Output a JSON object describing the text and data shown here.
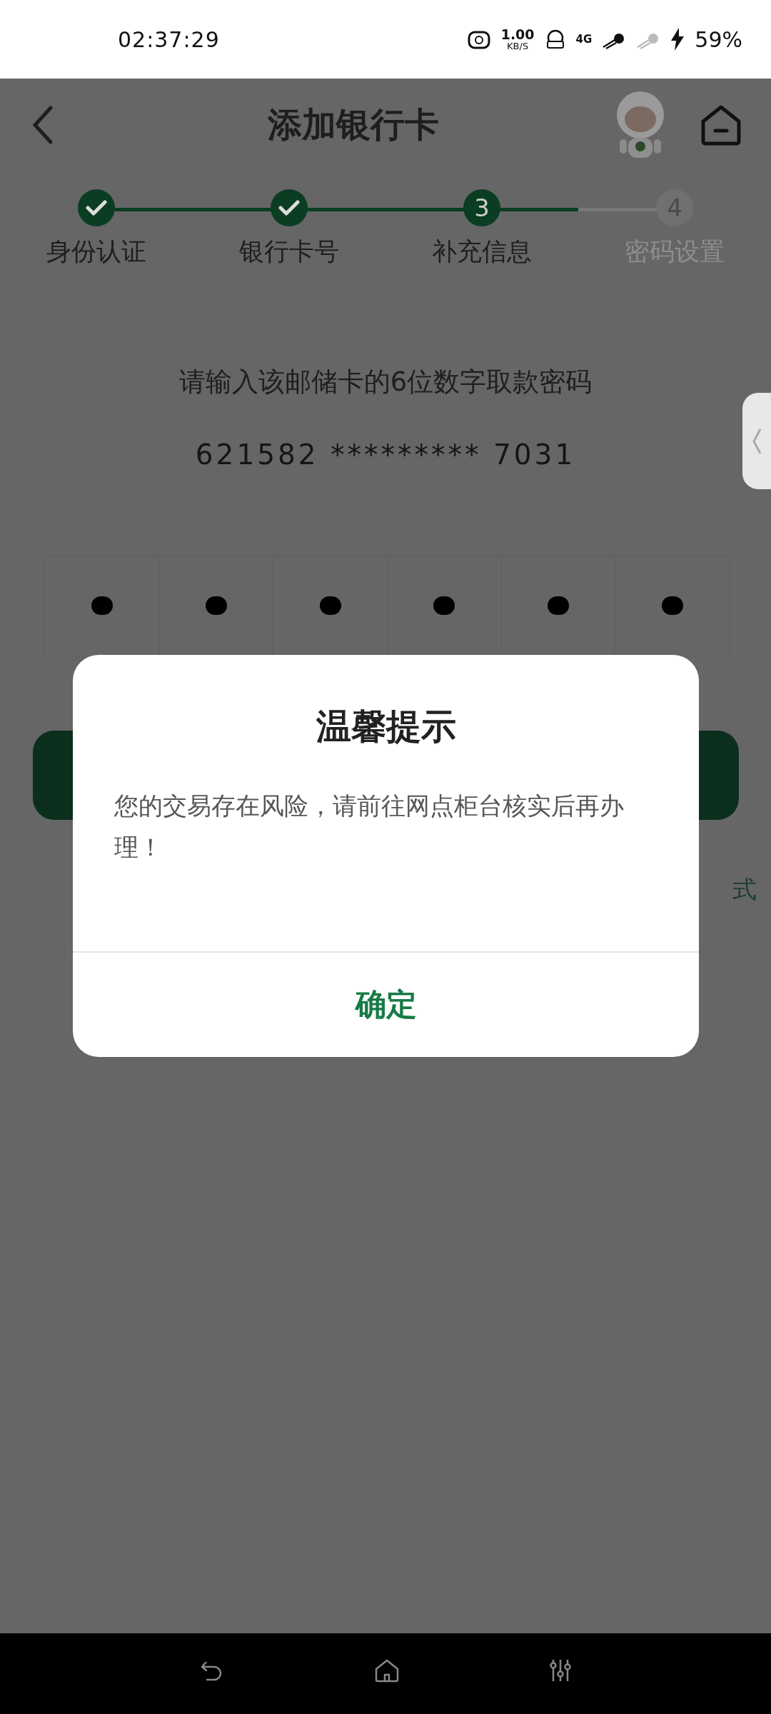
{
  "status_bar": {
    "time": "02:37:29",
    "speed_value": "1.00",
    "speed_unit": "KB/S",
    "network": "4G",
    "battery": "59%"
  },
  "header": {
    "title": "添加银行卡"
  },
  "steps": [
    {
      "label": "身份认证",
      "completed": true,
      "selected": false
    },
    {
      "label": "银行卡号",
      "completed": true,
      "selected": false
    },
    {
      "label": "补充信息",
      "completed": false,
      "selected": true,
      "number": "3"
    },
    {
      "label": "密码设置",
      "completed": false,
      "selected": false,
      "number": "4"
    }
  ],
  "prompt": "请输入该邮储卡的6位数字取款密码",
  "card_number": "621582 ********* 7031",
  "pin_cells": [
    {
      "filled": true
    },
    {
      "filled": true
    },
    {
      "filled": true
    },
    {
      "filled": true
    },
    {
      "filled": true
    },
    {
      "filled": true
    }
  ],
  "link_fragment": "式",
  "dialog": {
    "title": "温馨提示",
    "message": "您的交易存在风险，请前往网点柜台核实后再办理！",
    "button": "确定"
  }
}
